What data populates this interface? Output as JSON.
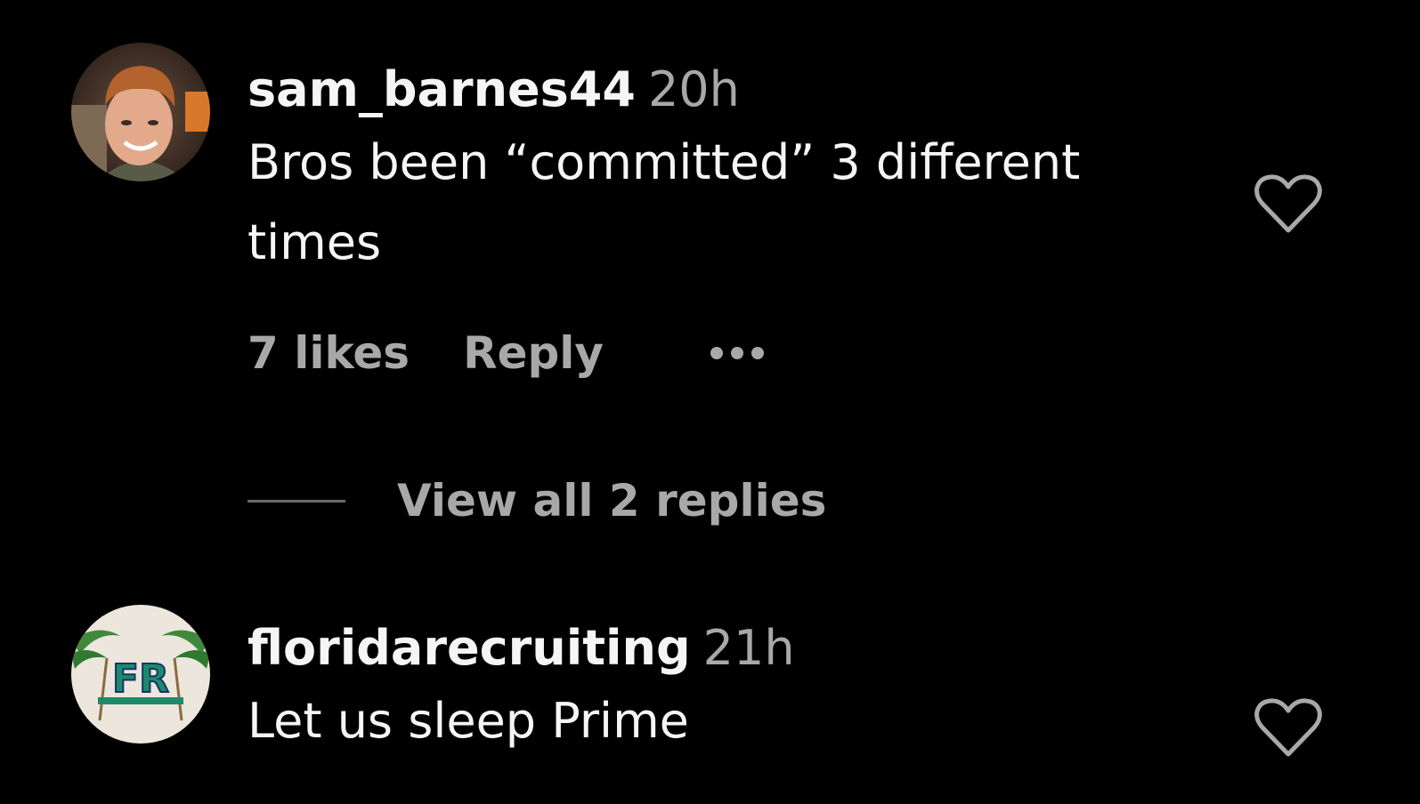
{
  "comments": [
    {
      "username": "sam_barnes44",
      "time": "20h",
      "text": "Bros been “committed” 3 different times",
      "likes": "7 likes",
      "reply_label": "Reply",
      "view_replies": "View all 2 replies"
    },
    {
      "username": "floridarecruiting",
      "time": "21h",
      "text": "Let us sleep Prime",
      "avatar_text": "FR"
    }
  ],
  "colors": {
    "background": "#000000",
    "primary_text": "#f5f5f5",
    "secondary_text": "#a8a8a8"
  },
  "icons": {
    "like": "heart-outline-icon",
    "more": "more-options-icon"
  }
}
